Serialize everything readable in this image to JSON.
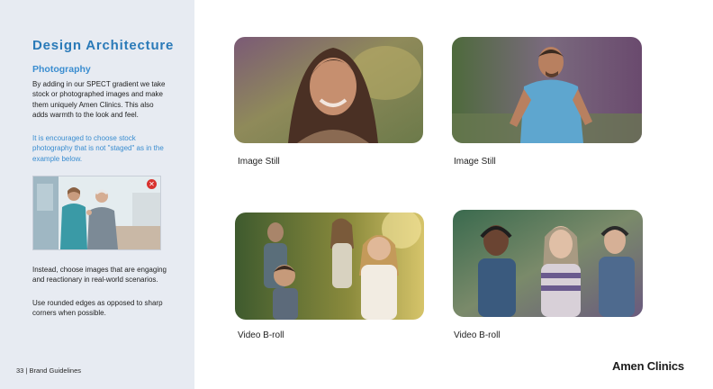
{
  "sidebar": {
    "title": "Design Architecture",
    "subtitle": "Photography",
    "paragraph1": "By adding in our SPECT gradient we take stock or photographed images and make them uniquely Amen Clinics. This also adds warmth to the look and feel.",
    "paragraph2": "It is encouraged to choose stock photography that is not \"staged\" as in the example below.",
    "paragraph3": "Instead, choose images that are engaging and reactionary in real-world scenarios.",
    "paragraph4": "Use rounded edges as opposed to sharp corners when possible.",
    "example_icon": "not-allowed-icon",
    "footer": "33 | Brand Guidelines"
  },
  "gallery": {
    "items": [
      {
        "caption": "Image Still",
        "subject": "woman-portrait-photo"
      },
      {
        "caption": "Image Still",
        "subject": "man-running-photo"
      },
      {
        "caption": "Video B-roll",
        "subject": "family-running-photo"
      },
      {
        "caption": "Video B-roll",
        "subject": "teens-headphones-photo"
      }
    ]
  },
  "logo": {
    "text": "Amen Clinics"
  },
  "colors": {
    "accent": "#2a7ab8",
    "sidebar_bg": "#e7ebf2",
    "reject": "#d8332f"
  }
}
